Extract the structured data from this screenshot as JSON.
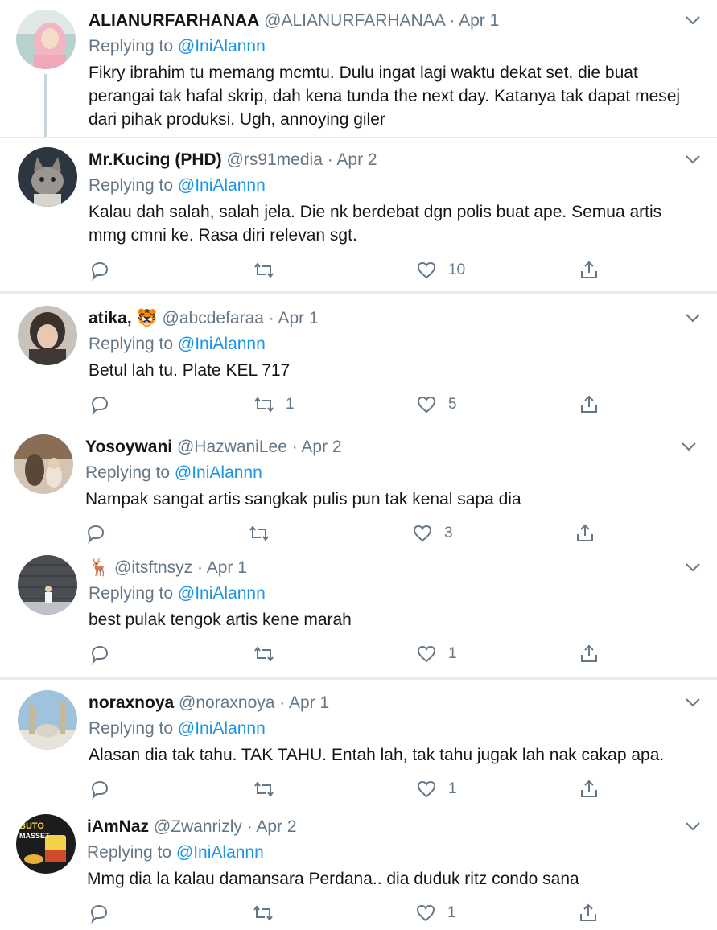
{
  "tweets": [
    {
      "name": "ALIANURFARHANAA",
      "handle": "@ALIANURFARHANAA",
      "date": "Apr 1",
      "replying_prefix": "Replying to",
      "replying_to": "@IniAlannn",
      "text": "Fikry ibrahim tu memang mcmtu. Dulu ingat lagi waktu dekat set, die buat perangai tak hafal skrip, dah kena tunda the next day. Katanya tak dapat mesej dari pihak produksi. Ugh, annoying giler",
      "reply_count": "",
      "retweet_count": "",
      "like_count": "",
      "avatar_color": "#e8a9b7"
    },
    {
      "name": "Mr.Kucing (PHD)",
      "handle": "@rs91media",
      "date": "Apr 2",
      "replying_prefix": "Replying to",
      "replying_to": "@IniAlannn",
      "text": "Kalau dah salah, salah jela. Die nk berdebat dgn polis buat ape. Semua artis mmg cmni ke. Rasa diri relevan sgt.",
      "reply_count": "",
      "retweet_count": "",
      "like_count": "10",
      "avatar_color": "#2d3540"
    },
    {
      "name": "atika,",
      "name_emoji": "🐯",
      "handle": "@abcdefaraa",
      "date": "Apr 1",
      "replying_prefix": "Replying to",
      "replying_to": "@IniAlannn",
      "text": "Betul lah tu. Plate KEL 717",
      "reply_count": "",
      "retweet_count": "1",
      "like_count": "5",
      "avatar_color": "#6b5b50"
    },
    {
      "name": "Yosoywani",
      "handle": "@HazwaniLee",
      "date": "Apr 2",
      "replying_prefix": "Replying to",
      "replying_to": "@IniAlannn",
      "text": "Nampak sangat artis sangkak pulis pun tak kenal sapa dia",
      "reply_count": "",
      "retweet_count": "",
      "like_count": "3",
      "avatar_color": "#8a6d55"
    },
    {
      "name": "",
      "name_emoji": "🦌",
      "handle": "@itsftnsyz",
      "date": "Apr 1",
      "replying_prefix": "Replying to",
      "replying_to": "@IniAlannn",
      "text": "best pulak tengok artis kene marah",
      "reply_count": "",
      "retweet_count": "",
      "like_count": "1",
      "avatar_color": "#4a4d52"
    },
    {
      "name": "noraxnoya",
      "handle": "@noraxnoya",
      "date": "Apr 1",
      "replying_prefix": "Replying to",
      "replying_to": "@IniAlannn",
      "text": "Alasan dia tak tahu. TAK TAHU. Entah lah, tak tahu jugak lah nak cakap apa.",
      "reply_count": "",
      "retweet_count": "",
      "like_count": "1",
      "avatar_color": "#9fc3dd"
    },
    {
      "name": "iAmNaz",
      "handle": "@Zwanrizly",
      "date": "Apr 2",
      "replying_prefix": "Replying to",
      "replying_to": "@IniAlannn",
      "text": "Mmg dia la kalau damansara Perdana.. dia duduk ritz condo sana",
      "reply_count": "",
      "retweet_count": "",
      "like_count": "1",
      "avatar_color": "#1c1c1c",
      "avatar_text": [
        "BUTO",
        "MASSET"
      ]
    }
  ],
  "colors": {
    "link": "#1b95e0",
    "secondary": "#657786",
    "text": "#14171a",
    "divider": "#e1e8ed"
  },
  "icons": {
    "reply": "reply-icon",
    "retweet": "retweet-icon",
    "like": "heart-icon",
    "share": "share-icon",
    "more": "chevron-down-icon"
  }
}
